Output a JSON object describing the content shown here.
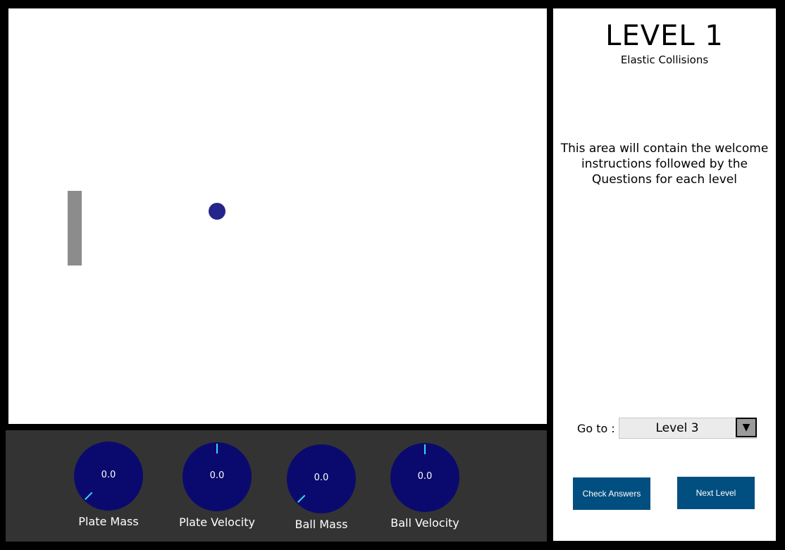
{
  "simulation": {
    "plate": {
      "color": "#8c8c8c"
    },
    "ball": {
      "color": "#24248c"
    }
  },
  "controls": {
    "knobs": [
      {
        "label": "Plate Mass",
        "value": "0.0",
        "pointer": "min"
      },
      {
        "label": "Plate Velocity",
        "value": "0.0",
        "pointer": "center"
      },
      {
        "label": "Ball Mass",
        "value": "0.0",
        "pointer": "min"
      },
      {
        "label": "Ball Velocity",
        "value": "0.0",
        "pointer": "center"
      }
    ],
    "knob_color": "#0a0a6e",
    "pointer_color": "#3ad6f0"
  },
  "panel": {
    "title": "LEVEL 1",
    "subtitle": "Elastic Collisions",
    "instructions": "This area will contain the welcome instructions followed by the Questions for each level",
    "goto_label": "Go to :",
    "goto_selected": "Level 3",
    "check_answers_label": "Check Answers",
    "next_level_label": "Next Level",
    "button_color": "#014f80"
  }
}
